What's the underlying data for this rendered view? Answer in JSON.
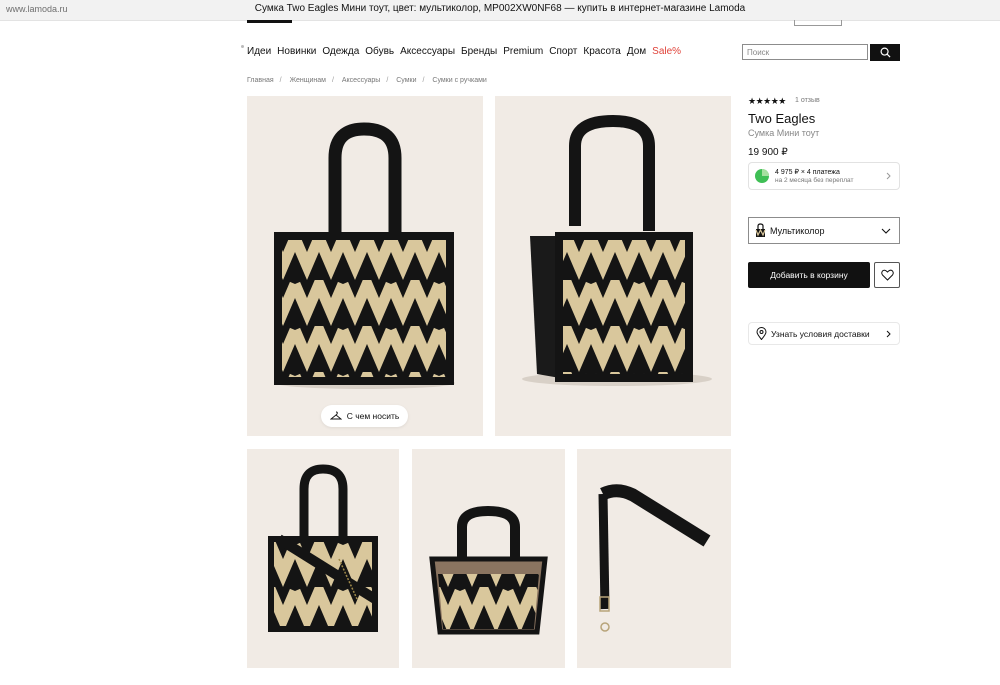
{
  "browser": {
    "url": "www.lamoda.ru",
    "title": "Сумка Two Eagles Мини тоут, цвет: мультиколор, MP002XW0NF68 — купить в интернет-магазине Lamoda"
  },
  "nav": {
    "items": [
      "Идеи",
      "Новинки",
      "Одежда",
      "Обувь",
      "Аксессуары",
      "Бренды",
      "Premium",
      "Спорт",
      "Красота",
      "Дом"
    ],
    "sale": "Sale%"
  },
  "search": {
    "placeholder": "Поиск"
  },
  "breadcrumbs": [
    "Главная",
    "Женщинам",
    "Аксессуары",
    "Сумки",
    "Сумки с ручками"
  ],
  "gallery": {
    "wear_button": "С чем носить"
  },
  "product": {
    "stars": "★★★★★",
    "reviews": "1 отзыв",
    "brand": "Two Eagles",
    "name": "Сумка Мини тоут",
    "price": "19 900 ₽",
    "split": {
      "line1": "4 975 ₽ × 4 платежа",
      "line2": "на 2 месяца без переплат"
    },
    "color": "Мультиколор",
    "add_to_cart": "Добавить в корзину",
    "delivery": "Узнать условия доставки"
  },
  "colors": {
    "accent": "#111111",
    "sale": "#e0433a",
    "photo_bg": "#f1ebe5",
    "bag_black": "#141414",
    "bag_beige": "#d9c79c"
  }
}
